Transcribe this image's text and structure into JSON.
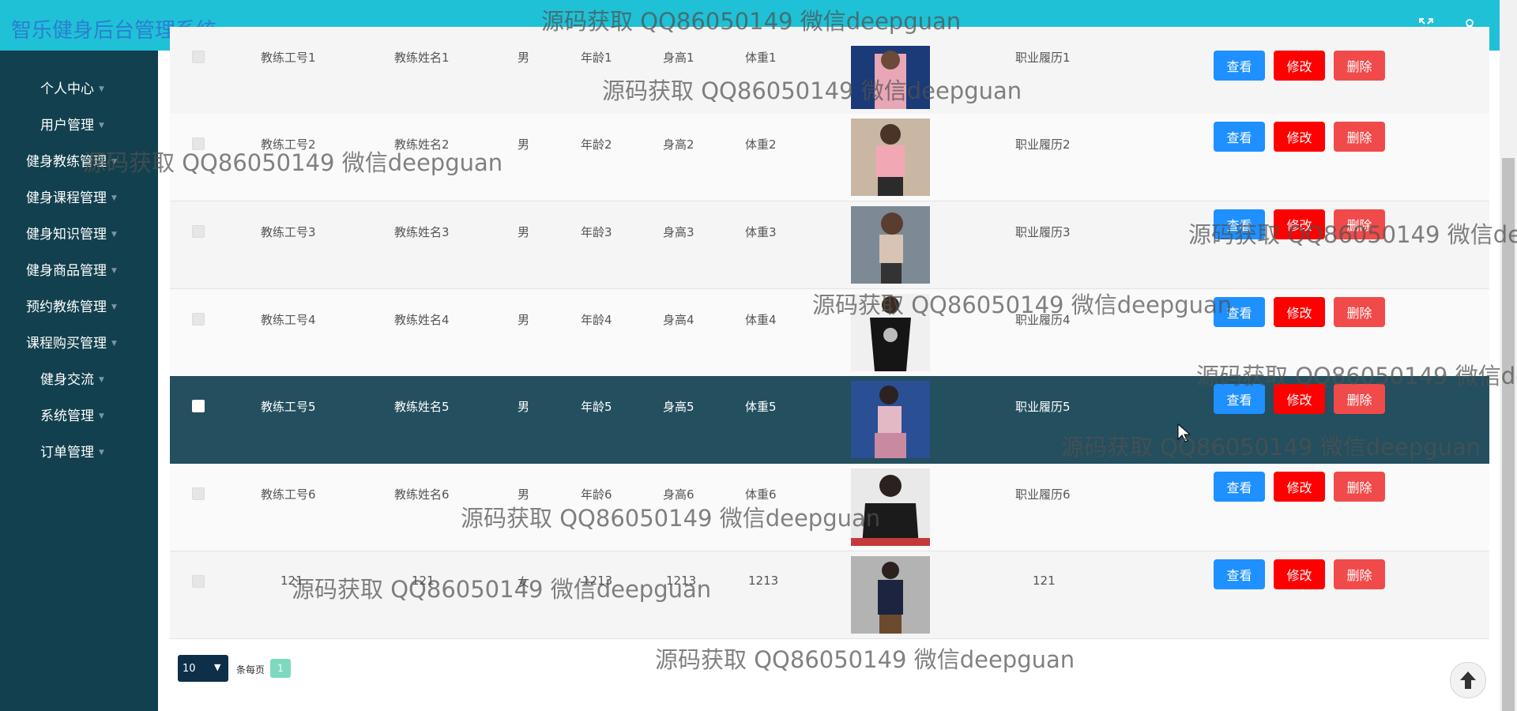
{
  "app": {
    "title": "智乐健身后台管理系统"
  },
  "colors": {
    "topbar": "#1fc1d6",
    "sidebar": "#12404e",
    "selected_row": "#234f5f",
    "view_btn": "#1e90ff",
    "edit_btn": "#ff0000",
    "delete_btn": "#f14a4a"
  },
  "header": {
    "fullscreen_icon": "expand-icon",
    "user_icon": "user-icon"
  },
  "sidebar": {
    "items": [
      {
        "label": "个人中心"
      },
      {
        "label": "用户管理"
      },
      {
        "label": "健身教练管理"
      },
      {
        "label": "健身课程管理"
      },
      {
        "label": "健身知识管理"
      },
      {
        "label": "健身商品管理"
      },
      {
        "label": "预约教练管理"
      },
      {
        "label": "课程购买管理"
      },
      {
        "label": "健身交流"
      },
      {
        "label": "系统管理"
      },
      {
        "label": "订单管理"
      }
    ]
  },
  "table": {
    "actions": {
      "view": "查看",
      "edit": "修改",
      "delete": "删除"
    },
    "rows": [
      {
        "id": "教练工号1",
        "name": "教练姓名1",
        "gender": "男",
        "age": "年龄1",
        "height": "身高1",
        "weight": "体重1",
        "resume": "职业履历1",
        "selected": false
      },
      {
        "id": "教练工号2",
        "name": "教练姓名2",
        "gender": "男",
        "age": "年龄2",
        "height": "身高2",
        "weight": "体重2",
        "resume": "职业履历2",
        "selected": false
      },
      {
        "id": "教练工号3",
        "name": "教练姓名3",
        "gender": "男",
        "age": "年龄3",
        "height": "身高3",
        "weight": "体重3",
        "resume": "职业履历3",
        "selected": false
      },
      {
        "id": "教练工号4",
        "name": "教练姓名4",
        "gender": "男",
        "age": "年龄4",
        "height": "身高4",
        "weight": "体重4",
        "resume": "职业履历4",
        "selected": false
      },
      {
        "id": "教练工号5",
        "name": "教练姓名5",
        "gender": "男",
        "age": "年龄5",
        "height": "身高5",
        "weight": "体重5",
        "resume": "职业履历5",
        "selected": true
      },
      {
        "id": "教练工号6",
        "name": "教练姓名6",
        "gender": "男",
        "age": "年龄6",
        "height": "身高6",
        "weight": "体重6",
        "resume": "职业履历6",
        "selected": false
      },
      {
        "id": "121",
        "name": "121",
        "gender": "女",
        "age": "1213",
        "height": "1213",
        "weight": "1213",
        "resume": "121",
        "selected": false
      }
    ]
  },
  "pagination": {
    "page_size": "10",
    "per_page_label": "条每页",
    "current_page": "1"
  },
  "watermark": {
    "text": "源码获取 QQ86050149 微信deepguan"
  },
  "back_to_top_icon": "arrow-up-icon"
}
